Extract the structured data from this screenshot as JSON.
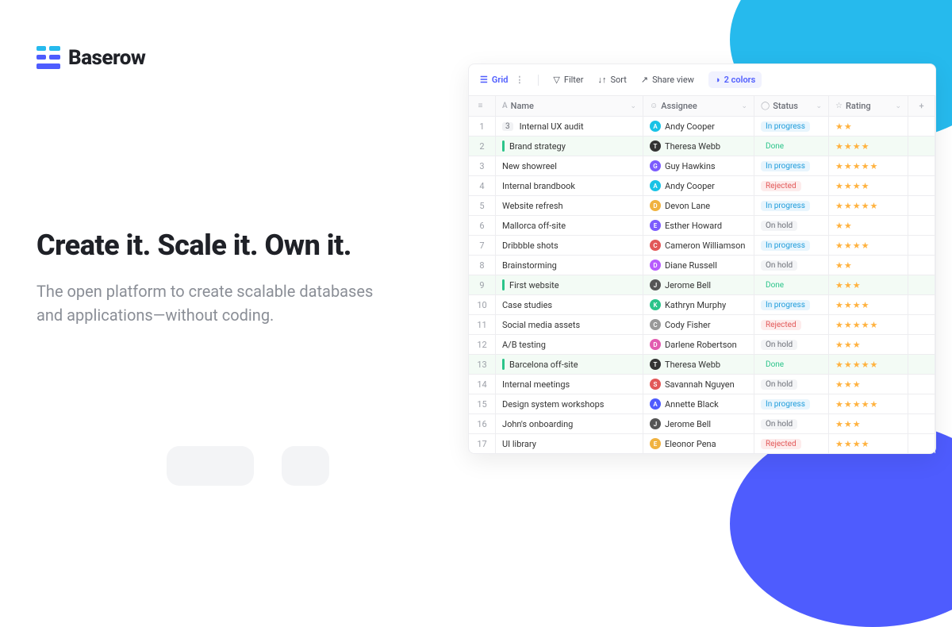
{
  "brand": "Baserow",
  "headline": "Create it. Scale it. Own it.",
  "subhead": "The open platform to create scalable databases and applications—without coding.",
  "toolbar": {
    "view": "Grid",
    "filter": "Filter",
    "sort": "Sort",
    "share": "Share view",
    "colors": "2 colors"
  },
  "columns": {
    "name": "Name",
    "assignee": "Assignee",
    "status": "Status",
    "rating": "Rating"
  },
  "statuses": {
    "progress": "In progress",
    "done": "Done",
    "rejected": "Rejected",
    "hold": "On hold"
  },
  "rows": [
    {
      "n": "1",
      "badge": "3",
      "name": "Internal UX audit",
      "assignee": "Andy Cooper",
      "avatar": "#19C3E6",
      "initial": "A",
      "status": "progress",
      "stars": 2,
      "done": false
    },
    {
      "n": "2",
      "name": "Brand strategy",
      "assignee": "Theresa Webb",
      "avatar": "#333",
      "initial": "T",
      "status": "done",
      "stars": 4,
      "done": true
    },
    {
      "n": "3",
      "name": "New showreel",
      "assignee": "Guy Hawkins",
      "avatar": "#7C5CFE",
      "initial": "G",
      "status": "progress",
      "stars": 5,
      "done": false
    },
    {
      "n": "4",
      "name": "Internal brandbook",
      "assignee": "Andy Cooper",
      "avatar": "#19C3E6",
      "initial": "A",
      "status": "rejected",
      "stars": 4,
      "done": false
    },
    {
      "n": "5",
      "name": "Website refresh",
      "assignee": "Devon Lane",
      "avatar": "#F0B23F",
      "initial": "D",
      "status": "progress",
      "stars": 5,
      "done": false
    },
    {
      "n": "6",
      "name": "Mallorca off-site",
      "assignee": "Esther Howard",
      "avatar": "#7C5CFE",
      "initial": "E",
      "status": "hold",
      "stars": 2,
      "done": false
    },
    {
      "n": "7",
      "name": "Dribbble shots",
      "assignee": "Cameron Williamson",
      "avatar": "#E25858",
      "initial": "C",
      "status": "progress",
      "stars": 4,
      "done": false
    },
    {
      "n": "8",
      "name": "Brainstorming",
      "assignee": "Diane Russell",
      "avatar": "#B75CFE",
      "initial": "D",
      "status": "hold",
      "stars": 2,
      "done": false
    },
    {
      "n": "9",
      "name": "First website",
      "assignee": "Jerome Bell",
      "avatar": "#555",
      "initial": "J",
      "status": "done",
      "stars": 3,
      "done": true
    },
    {
      "n": "10",
      "name": "Case studies",
      "assignee": "Kathryn Murphy",
      "avatar": "#2BC48A",
      "initial": "K",
      "status": "progress",
      "stars": 4,
      "done": false
    },
    {
      "n": "11",
      "name": "Social media assets",
      "assignee": "Cody Fisher",
      "avatar": "#999",
      "initial": "C",
      "status": "rejected",
      "stars": 5,
      "done": false
    },
    {
      "n": "12",
      "name": "A/B testing",
      "assignee": "Darlene Robertson",
      "avatar": "#E25CB0",
      "initial": "D",
      "status": "hold",
      "stars": 3,
      "done": false
    },
    {
      "n": "13",
      "name": "Barcelona off-site",
      "assignee": "Theresa Webb",
      "avatar": "#333",
      "initial": "T",
      "status": "done",
      "stars": 5,
      "done": true
    },
    {
      "n": "14",
      "name": "Internal meetings",
      "assignee": "Savannah Nguyen",
      "avatar": "#E25858",
      "initial": "S",
      "status": "hold",
      "stars": 3,
      "done": false
    },
    {
      "n": "15",
      "name": "Design system workshops",
      "assignee": "Annette Black",
      "avatar": "#4E5CFE",
      "initial": "A",
      "status": "progress",
      "stars": 5,
      "done": false
    },
    {
      "n": "16",
      "name": "John's onboarding",
      "assignee": "Jerome Bell",
      "avatar": "#555",
      "initial": "J",
      "status": "hold",
      "stars": 3,
      "done": false
    },
    {
      "n": "17",
      "name": "UI library",
      "assignee": "Eleonor Pena",
      "avatar": "#F0B23F",
      "initial": "E",
      "status": "rejected",
      "stars": 4,
      "done": false
    }
  ]
}
